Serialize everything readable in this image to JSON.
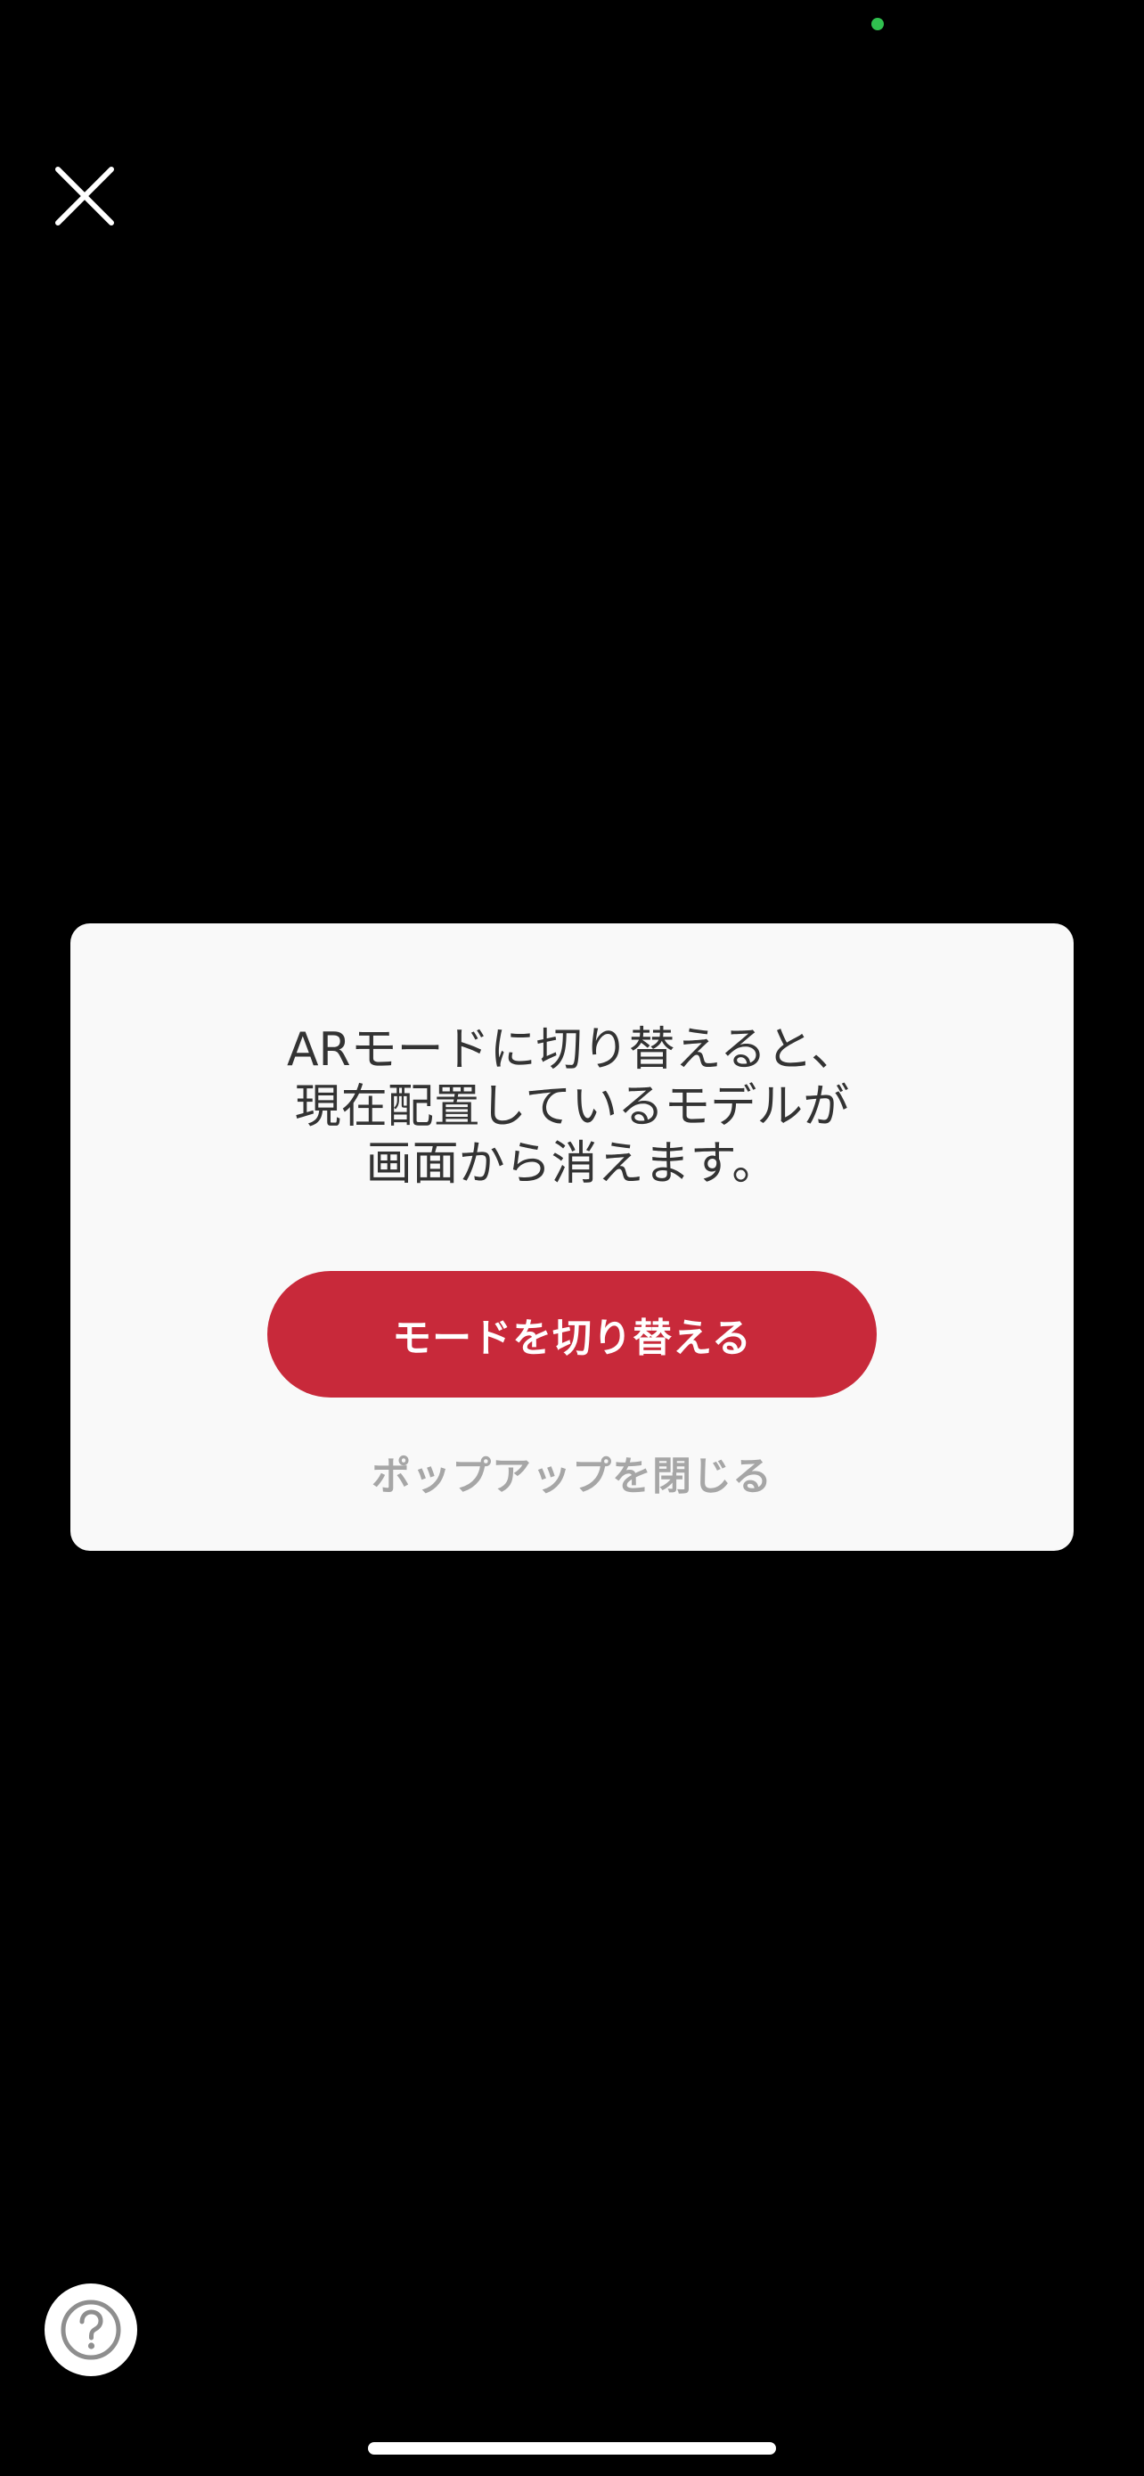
{
  "status": {
    "indicator_color": "#30c04f",
    "indicator_icon": "camera-in-use-dot"
  },
  "header": {
    "close_icon": "close-icon"
  },
  "dialog": {
    "message": "ARモードに切り替えると、\n現在配置しているモデルが\n画面から消えます。",
    "primary_button_label": "モードを切り替える",
    "secondary_link_label": "ポップアップを閉じる",
    "primary_color": "#c8293a"
  },
  "footer": {
    "help_icon": "question-mark-icon"
  }
}
